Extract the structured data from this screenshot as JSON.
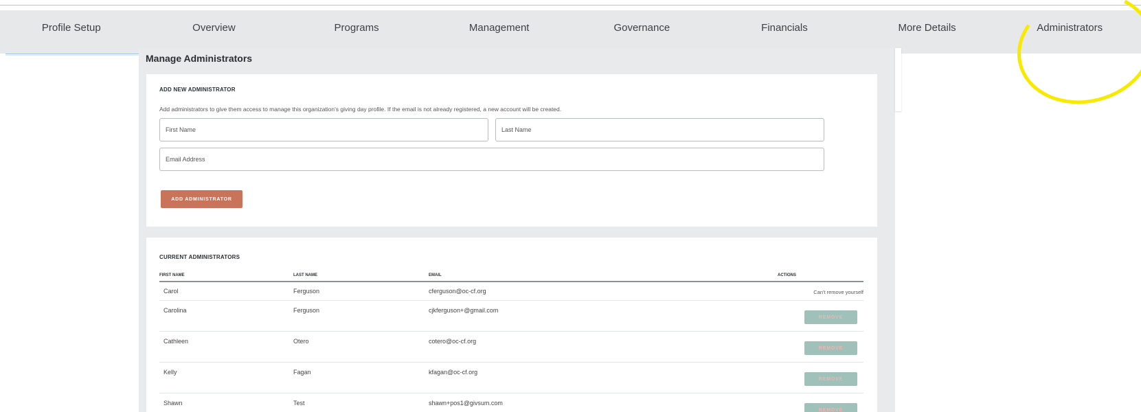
{
  "tabs": [
    {
      "label": "Profile Setup"
    },
    {
      "label": "Overview"
    },
    {
      "label": "Programs"
    },
    {
      "label": "Management"
    },
    {
      "label": "Governance"
    },
    {
      "label": "Financials"
    },
    {
      "label": "More Details"
    },
    {
      "label": "Administrators"
    }
  ],
  "page_title": "Manage Administrators",
  "add_section": {
    "heading": "ADD NEW ADMINISTRATOR",
    "description": "Add administrators to give them access to manage this organization's giving day profile. If the email is not already registered, a new account will be created.",
    "first_name_placeholder": "First Name",
    "last_name_placeholder": "Last Name",
    "email_placeholder": "Email Address",
    "add_button": "ADD ADMINISTRATOR"
  },
  "current_section": {
    "heading": "CURRENT ADMINISTRATORS",
    "columns": {
      "first": "FIRST NAME",
      "last": "LAST NAME",
      "email": "EMAIL",
      "actions": "ACTIONS"
    },
    "rows": [
      {
        "first": "Carol",
        "last": "Ferguson",
        "email": "cferguson@oc-cf.org",
        "action_text": "Can't remove yourself"
      },
      {
        "first": "Carolina",
        "last": "Ferguson",
        "email": "cjkferguson+@gmail.com",
        "action_button": "REMOVE"
      },
      {
        "first": "Cathleen",
        "last": "Otero",
        "email": "cotero@oc-cf.org",
        "action_button": "REMOVE"
      },
      {
        "first": "Kelly",
        "last": "Fagan",
        "email": "kfagan@oc-cf.org",
        "action_button": "REMOVE"
      },
      {
        "first": "Shawn",
        "last": "Test",
        "email": "shawn+pos1@givsum.com",
        "action_button": "REMOVE"
      }
    ]
  },
  "colors": {
    "accent_button": "#c9745a",
    "remove_button": "#9fc1b9",
    "highlight": "#f7ea00"
  }
}
